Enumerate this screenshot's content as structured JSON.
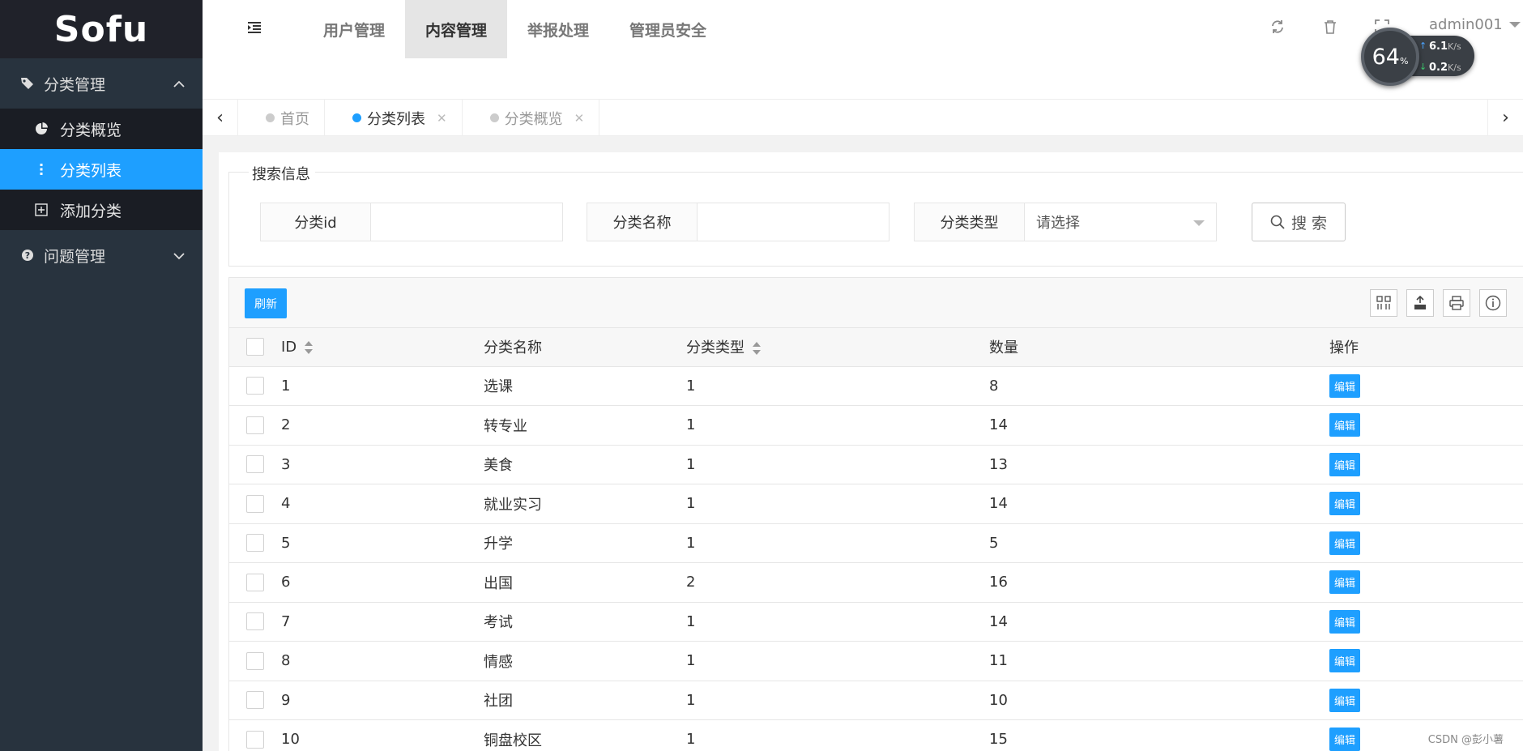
{
  "sidebar": {
    "logo": "Sofu",
    "group1": {
      "label": "分类管理",
      "icon": "tags-icon"
    },
    "items": [
      {
        "label": "分类概览",
        "icon": "pie-chart-icon"
      },
      {
        "label": "分类列表",
        "icon": "vertical-dots-icon"
      },
      {
        "label": "添加分类",
        "icon": "plus-square-icon"
      }
    ],
    "group2": {
      "label": "问题管理",
      "icon": "question-circle-icon"
    }
  },
  "header": {
    "nav": [
      "用户管理",
      "内容管理",
      "举报处理",
      "管理员安全"
    ],
    "active_nav": "内容管理",
    "username": "admin001"
  },
  "speed_widget": {
    "percent": "64",
    "percent_unit": "%",
    "upload": "6.1",
    "download": "0.2",
    "unit": "K/s"
  },
  "tabs": [
    {
      "label": "首页",
      "closable": false
    },
    {
      "label": "分类列表",
      "closable": true,
      "active": true
    },
    {
      "label": "分类概览",
      "closable": true
    }
  ],
  "search": {
    "legend": "搜索信息",
    "fields": [
      {
        "label": "分类id",
        "value": ""
      },
      {
        "label": "分类名称",
        "value": ""
      },
      {
        "label": "分类类型",
        "placeholder": "请选择"
      }
    ],
    "button": "搜 索"
  },
  "table": {
    "refresh_label": "刷新",
    "columns": [
      "ID",
      "分类名称",
      "分类类型",
      "数量",
      "操作"
    ],
    "rows": [
      [
        "1",
        "选课",
        "1",
        "8"
      ],
      [
        "2",
        "转专业",
        "1",
        "14"
      ],
      [
        "3",
        "美食",
        "1",
        "13"
      ],
      [
        "4",
        "就业实习",
        "1",
        "14"
      ],
      [
        "5",
        "升学",
        "1",
        "5"
      ],
      [
        "6",
        "出国",
        "2",
        "16"
      ],
      [
        "7",
        "考试",
        "1",
        "14"
      ],
      [
        "8",
        "情感",
        "1",
        "11"
      ],
      [
        "9",
        "社团",
        "1",
        "10"
      ],
      [
        "10",
        "铜盘校区",
        "1",
        "15"
      ]
    ],
    "edit_label": "编辑"
  },
  "watermark": "CSDN @彭小薯",
  "colors": {
    "accent": "#1e9fff",
    "sidebar": "#28333e",
    "logo_bg": "#20222a"
  }
}
